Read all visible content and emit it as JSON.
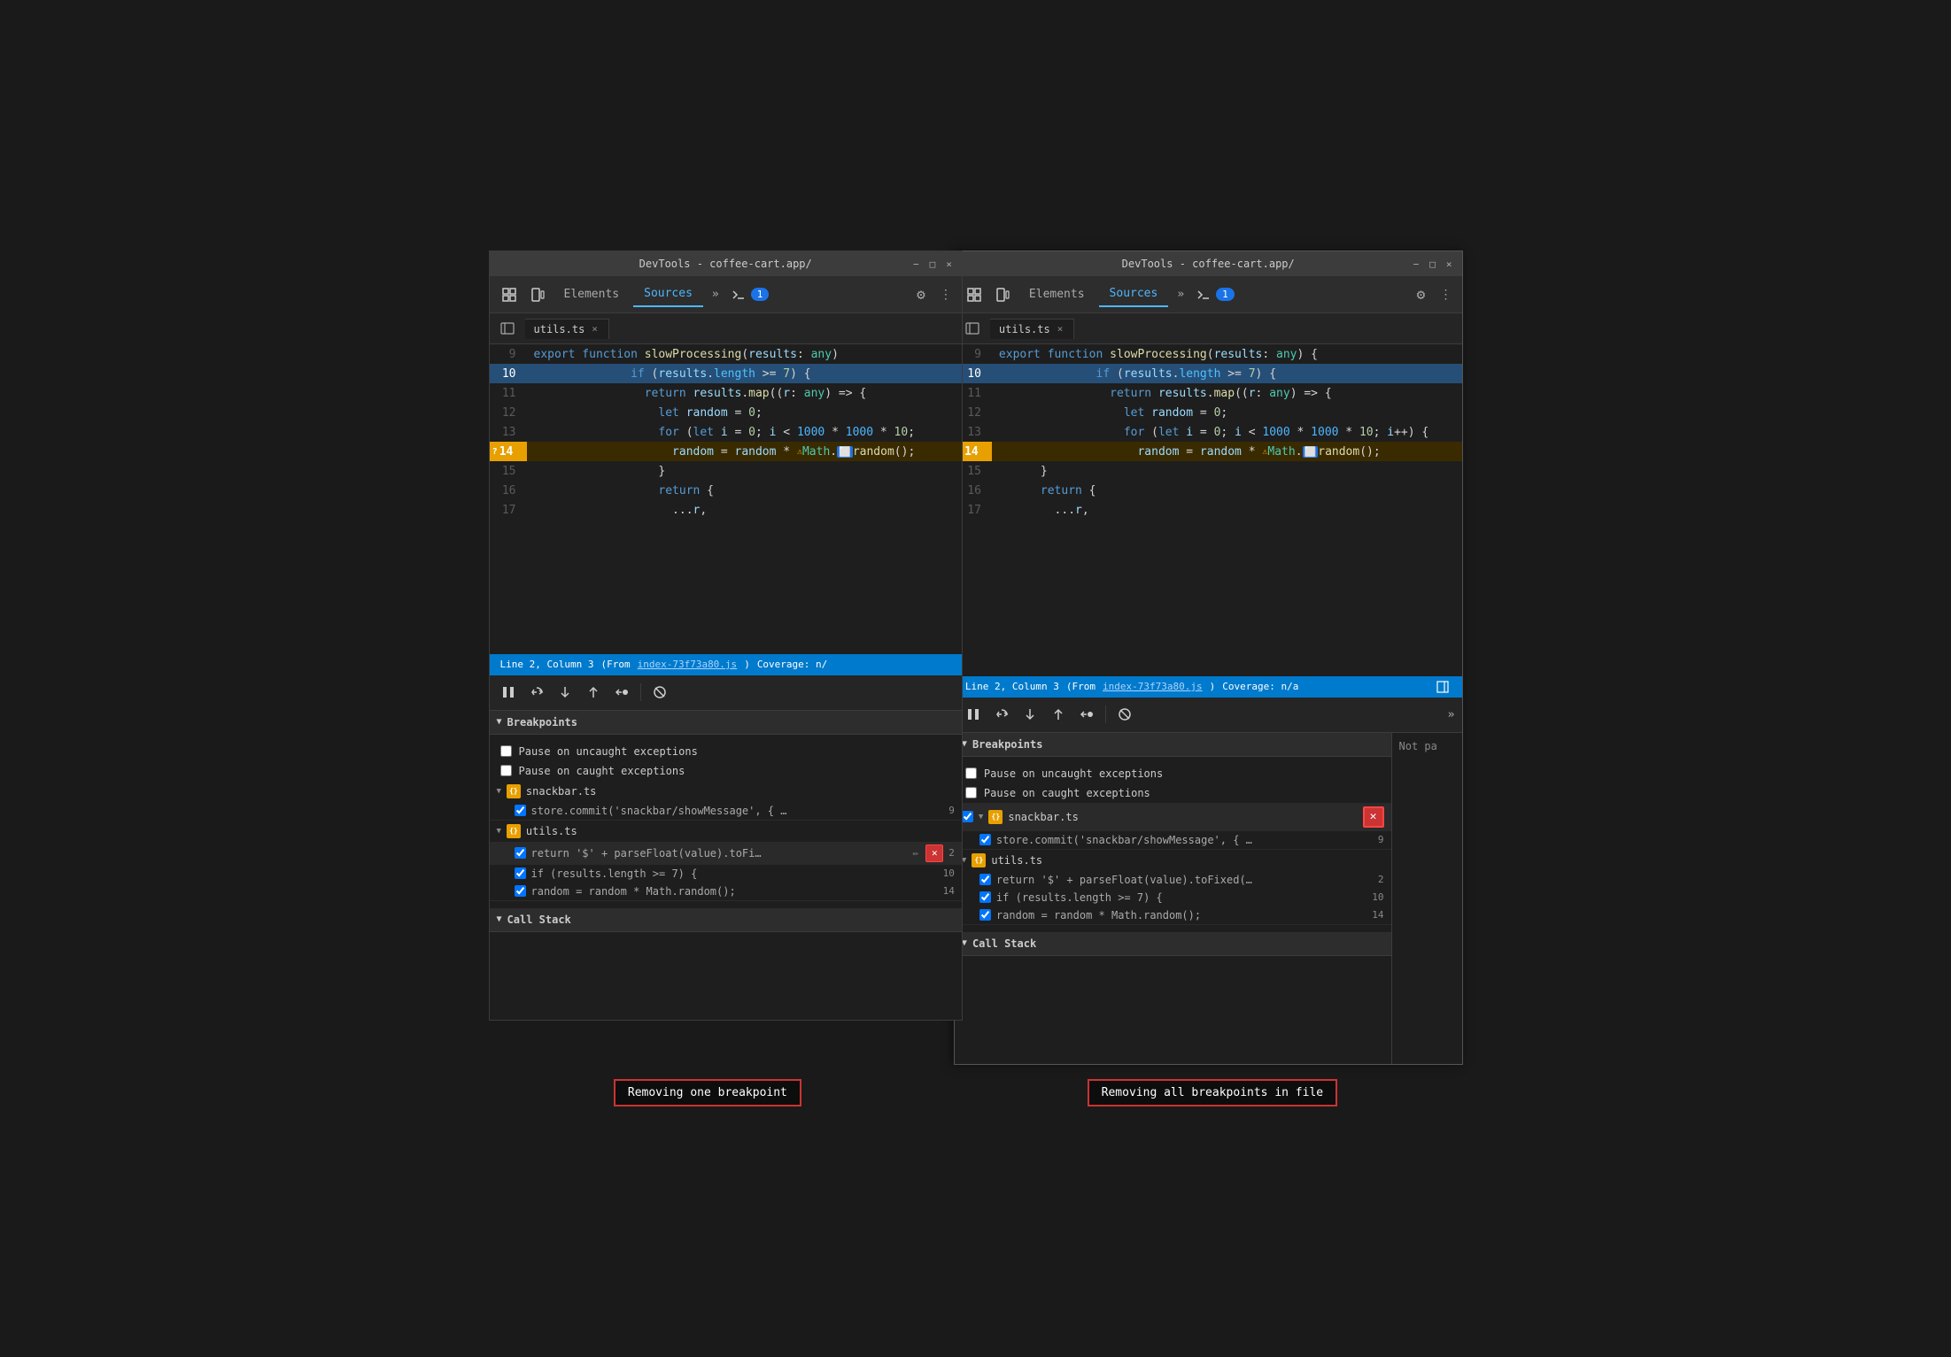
{
  "left_panel": {
    "title_bar": {
      "text": "DevTools - coffee-cart.app/",
      "controls": [
        "−",
        "□",
        "×"
      ]
    },
    "toolbar": {
      "tabs": [
        {
          "label": "Elements",
          "active": false
        },
        {
          "label": "Sources",
          "active": true
        },
        {
          "label": "»",
          "active": false
        }
      ],
      "console_badge": "1",
      "settings_icon": "⚙",
      "more_icon": "⋮"
    },
    "file_tab": {
      "name": "utils.ts",
      "has_close": true
    },
    "code_lines": [
      {
        "num": "9",
        "content": "export function slowProcessing(results: any)",
        "type": "normal"
      },
      {
        "num": "10",
        "content": "  if (results.length >= 7) {",
        "type": "highlighted"
      },
      {
        "num": "11",
        "content": "    return results.map((r: any) => {",
        "type": "normal"
      },
      {
        "num": "12",
        "content": "      let random = 0;",
        "type": "normal"
      },
      {
        "num": "13",
        "content": "      for (let i = 0; i < 1000 * 1000 * 10;",
        "type": "normal"
      },
      {
        "num": "14",
        "content": "        random = random * ⚠Math.⬜random();",
        "type": "breakpoint"
      },
      {
        "num": "15",
        "content": "      }",
        "type": "normal"
      },
      {
        "num": "16",
        "content": "      return {",
        "type": "normal"
      },
      {
        "num": "17",
        "content": "        ...r,",
        "type": "normal"
      }
    ],
    "status_bar": {
      "position": "Line 2, Column 3",
      "source_map": "(From index-73f73a80.js)",
      "source_link": "index-73f73a80.js",
      "coverage": "Coverage: n/"
    },
    "debug_buttons": [
      "⏸⏸",
      "↺",
      "⬇",
      "⬆",
      "→•",
      "↩"
    ],
    "breakpoints_section": {
      "title": "Breakpoints",
      "pause_uncaught": "Pause on uncaught exceptions",
      "pause_caught": "Pause on caught exceptions",
      "groups": [
        {
          "file": "snackbar.ts",
          "items": [
            {
              "code": "store.commit('snackbar/showMessage', { …",
              "line": "9",
              "checked": true
            }
          ]
        },
        {
          "file": "utils.ts",
          "items": [
            {
              "code": "return '$' + parseFloat(value).toFi…",
              "line": "2",
              "checked": true,
              "show_remove": true,
              "show_edit": true
            },
            {
              "code": "if (results.length >= 7) {",
              "line": "10",
              "checked": true
            },
            {
              "code": "random = random * Math.random();",
              "line": "14",
              "checked": true
            }
          ]
        }
      ]
    },
    "call_stack_title": "Call Stack"
  },
  "right_panel": {
    "title_bar": {
      "text": "DevTools - coffee-cart.app/",
      "controls": [
        "−",
        "□",
        "×"
      ]
    },
    "toolbar": {
      "tabs": [
        {
          "label": "Elements",
          "active": false
        },
        {
          "label": "Sources",
          "active": true
        },
        {
          "label": "»",
          "active": false
        }
      ],
      "console_badge": "1",
      "settings_icon": "⚙",
      "more_icon": "⋮"
    },
    "file_tab": {
      "name": "utils.ts",
      "has_close": true
    },
    "code_lines": [
      {
        "num": "9",
        "content": "export function slowProcessing(results: any) {",
        "type": "normal"
      },
      {
        "num": "10",
        "content": "  if (results.length >= 7) {",
        "type": "highlighted"
      },
      {
        "num": "11",
        "content": "    return results.map((r: any) => {",
        "type": "normal"
      },
      {
        "num": "12",
        "content": "      let random = 0;",
        "type": "normal"
      },
      {
        "num": "13",
        "content": "      for (let i = 0; i < 1000 * 1000 * 10; i++) {",
        "type": "normal"
      },
      {
        "num": "14",
        "content": "        random = random * ⚠Math.⬜random();",
        "type": "breakpoint"
      },
      {
        "num": "15",
        "content": "      }",
        "type": "normal"
      },
      {
        "num": "16",
        "content": "      return {",
        "type": "normal"
      },
      {
        "num": "17",
        "content": "        ...r,",
        "type": "normal"
      }
    ],
    "status_bar": {
      "position": "Line 2, Column 3",
      "source_map": "(From index-73f73a80.js)",
      "source_link": "index-73f73a80.js",
      "coverage": "Coverage: n/a"
    },
    "debug_buttons": [
      "⏸⏸",
      "↺",
      "⬇",
      "⬆",
      "→•"
    ],
    "breakpoints_section": {
      "title": "Breakpoints",
      "pause_uncaught": "Pause on uncaught exceptions",
      "pause_caught": "Pause on caught exceptions",
      "groups": [
        {
          "file": "snackbar.ts",
          "items": [
            {
              "code": "store.commit('snackbar/showMessage', { …",
              "line": "9",
              "checked": true,
              "show_remove_all": true
            }
          ]
        },
        {
          "file": "utils.ts",
          "items": [
            {
              "code": "return '$' + parseFloat(value).toFixed(…",
              "line": "2",
              "checked": true
            },
            {
              "code": "if (results.length >= 7) {",
              "line": "10",
              "checked": true
            },
            {
              "code": "random = random * Math.random();",
              "line": "14",
              "checked": true
            }
          ]
        }
      ]
    },
    "call_stack_title": "Call Stack",
    "not_paused": "Not pa"
  },
  "labels": {
    "left": "Removing one breakpoint",
    "right": "Removing all breakpoints in file"
  }
}
